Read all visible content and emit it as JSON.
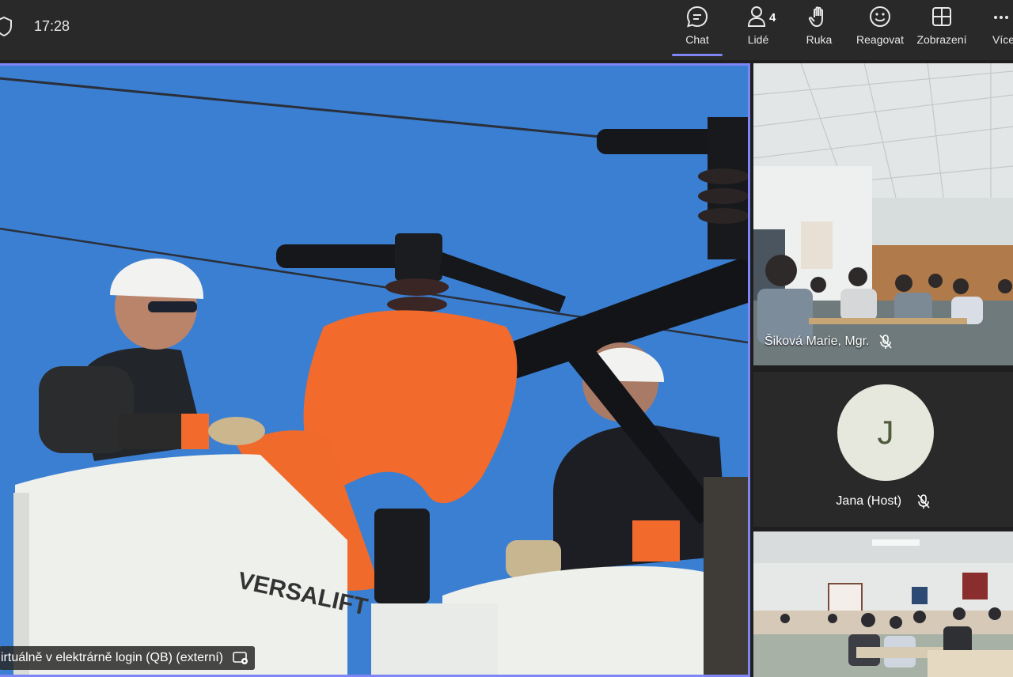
{
  "clock": "17:28",
  "toolbar": [
    {
      "label": "Chat",
      "icon": "chat-icon",
      "active": true
    },
    {
      "label": "Lidé",
      "icon": "people-icon",
      "badge": "4"
    },
    {
      "label": "Ruka",
      "icon": "raise-hand-icon"
    },
    {
      "label": "Reagovat",
      "icon": "emoji-icon"
    },
    {
      "label": "Zobrazení",
      "icon": "grid-view-icon"
    },
    {
      "label": "Více",
      "icon": "more-icon"
    }
  ],
  "main_video": {
    "caption": "irtuálně v elektrárně login (QB) (externí)"
  },
  "participants": [
    {
      "name": "Šiková Marie, Mgr.",
      "muted": true
    },
    {
      "name": "Jana (Host)",
      "initial": "J",
      "muted": true
    }
  ],
  "colors": {
    "accent": "#7f85f5",
    "sky": "#3b7fd2",
    "orange": "#f26a2c"
  }
}
